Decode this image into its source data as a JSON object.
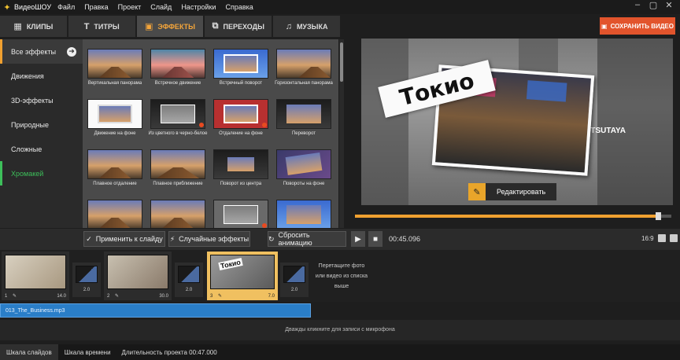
{
  "app": {
    "name": "ВидеоШОУ",
    "menu": [
      "Файл",
      "Правка",
      "Проект",
      "Слайд",
      "Настройки",
      "Справка"
    ]
  },
  "tabs": [
    {
      "label": "КЛИПЫ",
      "icon": "film-icon"
    },
    {
      "label": "ТИТРЫ",
      "icon": "titles-icon"
    },
    {
      "label": "ЭФФЕКТЫ",
      "icon": "effects-icon",
      "active": true
    },
    {
      "label": "ПЕРЕХОДЫ",
      "icon": "transitions-icon"
    },
    {
      "label": "МУЗЫКА",
      "icon": "music-icon"
    }
  ],
  "save_button": "СОХРАНИТЬ ВИДЕО",
  "categories": [
    {
      "label": "Все эффекты",
      "active": true
    },
    {
      "label": "Движения"
    },
    {
      "label": "3D-эффекты"
    },
    {
      "label": "Природные"
    },
    {
      "label": "Сложные"
    },
    {
      "label": "Хромакей",
      "accent": "#3dbf5a"
    }
  ],
  "effects": [
    {
      "label": "Вертикальная панорама"
    },
    {
      "label": "Встречное движение"
    },
    {
      "label": "Встречный поворот"
    },
    {
      "label": "Горизонтальная панорама"
    },
    {
      "label": "Движение на фоне"
    },
    {
      "label": "Из цветного в черно-белое"
    },
    {
      "label": "Отдаление на фоне"
    },
    {
      "label": "Переворот"
    },
    {
      "label": "Плавное отдаление"
    },
    {
      "label": "Плавное приближение"
    },
    {
      "label": "Поворот из центра"
    },
    {
      "label": "Повороты на фоне"
    },
    {
      "label": ""
    },
    {
      "label": ""
    },
    {
      "label": ""
    },
    {
      "label": ""
    }
  ],
  "preview": {
    "title_text": "Токио",
    "background_sign": "TSUTAYA",
    "edit_button": "Редактировать",
    "progress": 0.96
  },
  "toolbar": {
    "apply_button": "Применить к слайду",
    "random_button": "Случайные эффекты",
    "reset_button": "Сбросить анимацию",
    "timecode": "00:45.096",
    "aspect_ratio": "16:9"
  },
  "timeline": {
    "slides": [
      {
        "num": "1",
        "duration": "14.0"
      },
      {
        "num": "2",
        "duration": "30.0"
      },
      {
        "num": "3",
        "duration": "7.0",
        "selected": true,
        "text": "Токио"
      }
    ],
    "transitions": [
      "2.0",
      "2.0",
      "2.0"
    ],
    "drop_hint": "Перетащите фото или видео из списка выше",
    "audio_track": "013_The_Business.mp3",
    "mic_hint": "Дважды кликните для записи с микрофона"
  },
  "bottom": {
    "tab_slides": "Шкала слайдов",
    "tab_time": "Шкала времени",
    "duration": "Длительность проекта 00:47.000"
  },
  "colors": {
    "accent": "#f0a030",
    "save": "#e2542c",
    "audio": "#2a7ec8",
    "chroma": "#3dbf5a"
  }
}
